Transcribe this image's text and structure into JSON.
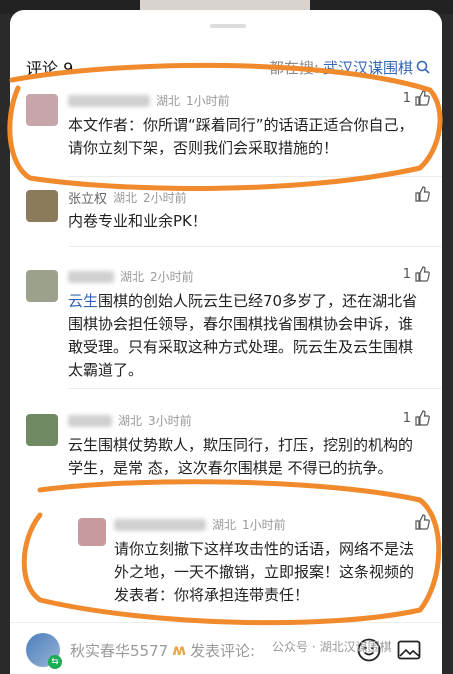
{
  "header": {
    "count_label": "评论 9",
    "search_prefix": "都在搜:",
    "search_query": "武汉汉谋围棋"
  },
  "comments": [
    {
      "location": "湖北",
      "time": "1小时前",
      "likes": "1",
      "text": "本文作者：你所谓“踩着同行”的话语正适合你自己，请你立刻下架，否则我们会采取措施的！"
    },
    {
      "author": "张立权",
      "location": "湖北",
      "time": "2小时前",
      "likes": "",
      "text": "内卷专业和业余PK！"
    },
    {
      "location": "湖北",
      "time": "2小时前",
      "likes": "1",
      "text_link": "云生",
      "text": "围棋的创始人阮云生已经70多岁了，还在湖北省围棋协会担任领导，春尔围棋找省围棋协会申诉，谁敢受理。只有采取这种方式处理。阮云生及云生围棋太霸道了。"
    },
    {
      "location": "湖北",
      "time": "3小时前",
      "likes": "1",
      "text": "云生围棋仗势欺人，欺压同行，打压，挖别的机构的学生，是常 态，这次春尔围棋是 不得已的抗争。"
    }
  ],
  "reply": {
    "location": "湖北",
    "time": "1小时前",
    "text": "请你立刻撤下这样攻击性的话语，网络不是法外之地，一天不撤销，立即报案！这条视频的发表者：你将承担连带责任！"
  },
  "bottom": {
    "username": "秋实春华5577",
    "placeholder": "发表评论:",
    "watermark_prefix": "公众号 ·",
    "watermark_name": "湖北汉谋围棋"
  },
  "colors": {
    "link": "#3367b5",
    "annotation": "#f08a2c"
  },
  "icons": [
    "search-icon",
    "thumb-up-icon",
    "emoji-icon",
    "image-icon",
    "wechat-icon"
  ]
}
